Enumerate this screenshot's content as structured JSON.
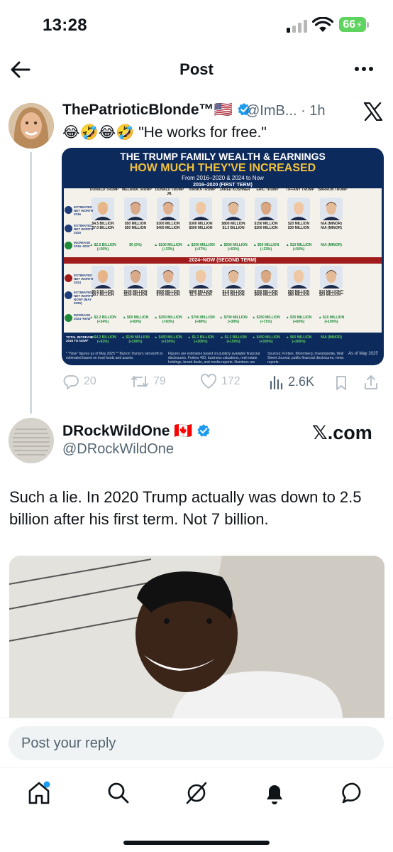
{
  "status_bar": {
    "time": "13:28",
    "battery": "66",
    "battery_color": "#5fd35f"
  },
  "header": {
    "title": "Post",
    "back_icon": "arrow-left-icon",
    "more_icon": "more-horizontal-icon"
  },
  "quoted_post": {
    "name": "ThePatrioticBlonde™🇺🇸",
    "handle_time": "@ImB... · 1h",
    "text": "😂🤣😂🤣 \"He works for free.\"",
    "close_icon": "x-logo-icon",
    "infographic": {
      "title_line1": "THE TRUMP FAMILY WEALTH & EARNINGS",
      "title_line2": "HOW MUCH THEY'VE INCREASED",
      "title_line3": "From 2016–2020 & 2024 to Now",
      "band1": "2016–2020 (FIRST TERM)",
      "band2": "2024–NOW (SECOND TERM)",
      "people": [
        "DONALD TRUMP",
        "MELANIA TRUMP",
        "DONALD TRUMP JR.",
        "IVANKA TRUMP",
        "JARED KUSHNER",
        "ERIC TRUMP",
        "TIFFANY TRUMP",
        "BARRON TRUMP"
      ],
      "row_labels": {
        "nw2016": "ESTIMATED NET WORTH 2016",
        "nw2020": "ESTIMATED NET WORTH 2020",
        "inc1": "INCREASE 2016–2020",
        "nw2024": "ESTIMATED NET WORTH 2024",
        "nwnow": "ESTIMATED NET WORTH NOW* (MAY 2025)",
        "inc2": "INCREASE 2024–NOW",
        "total": "TOTAL INCREASE 2016 TO NOW*"
      },
      "nw2016": [
        "$4.5 BILLION",
        "$50 MILLION",
        "$300 MILLION",
        "$300 MILLION",
        "$800 MILLION",
        "$150 MILLION",
        "$20 MILLION",
        "N/A (MINOR)"
      ],
      "nw2020": [
        "$7.0 BILLION",
        "$50 MILLION",
        "$400 MILLION",
        "$500 MILLION",
        "$1.3 BILLION",
        "$200 MILLION",
        "$30 MILLION",
        "N/A (MINOR)"
      ],
      "inc1": [
        "▲ $2.5 BILLION (+56%)",
        "$0 (0%)",
        "▲ $100 MILLION (+33%)",
        "▲ $200 MILLION (+67%)",
        "▲ $500 MILLION (+63%)",
        "▲ $50 MILLION (+33%)",
        "▲ $10 MILLION (+50%)",
        "N/A (MINOR)"
      ],
      "nw2024": [
        "$6.5 BILLION",
        "$100 MILLION",
        "$500 MILLION",
        "$800 MILLION",
        "$1.8 BILLION",
        "$350 MILLION",
        "$50 MILLION",
        "$10 MILLION**"
      ],
      "nwnow": [
        "$8.7 BILLION",
        "$150 MILLION",
        "$750 MILLION",
        "$1.5 BILLION",
        "$2.5 BILLION",
        "$600 MILLION",
        "$80 MILLION",
        "$20 MILLION**"
      ],
      "inc2": [
        "▲ $2.2 BILLION (+34%)",
        "▲ $50 MILLION (+50%)",
        "▲ $250 MILLION (+50%)",
        "▲ $700 MILLION (+88%)",
        "▲ $700 MILLION (+39%)",
        "▲ $250 MILLION (+71%)",
        "▲ $30 MILLION (+60%)",
        "▲ $10 MILLION (+100%)"
      ],
      "total": [
        "▲ $4.2 BILLION (+93%)",
        "▲ $100 MILLION (+200%)",
        "▲ $450 MILLION (+150%)",
        "▲ $1.2 BILLION (+300%)",
        "▲ $1.2 BILLION (+150%)",
        "▲ $450 MILLION (+300%)",
        "▲ $60 MILLION (+300%)",
        "N/A (MINOR)"
      ],
      "foot_left": "* \"Now\" figures as of May 2025   ** Barron Trump's net worth is estimated based on trust funds and assets.",
      "foot_mid": "Figures are estimates based on publicly available financial disclosures, Forbes 400, business valuations, real estate holdings, brand deals, and media reports. Numbers are approximate.",
      "foot_src": "Sources: Forbes, Bloomberg, Investopedia, Wall Street Journal, public financial disclosures, news reports.",
      "foot_date": "As of May 2025"
    },
    "actions": {
      "replies": "20",
      "reposts": "79",
      "likes": "172",
      "views": "2.6K"
    }
  },
  "reply_post": {
    "name": "DRockWildOne 🇨🇦",
    "handle": "@DRockWildOne",
    "source": "𝕏.com",
    "text": "Such a lie. In 2020 Trump actually was down to 2.5 billion after his first term. Not 7 billion."
  },
  "reply_bar": {
    "placeholder": "Post your reply"
  },
  "tabs": [
    "home-icon",
    "search-icon",
    "grok-icon",
    "notifications-icon",
    "messages-icon"
  ],
  "colors": {
    "verified": "#1d9bf0",
    "infographic_navy": "#0d2a5c",
    "infographic_gold": "#f3c23b",
    "increase_green": "#1d8a3a"
  }
}
